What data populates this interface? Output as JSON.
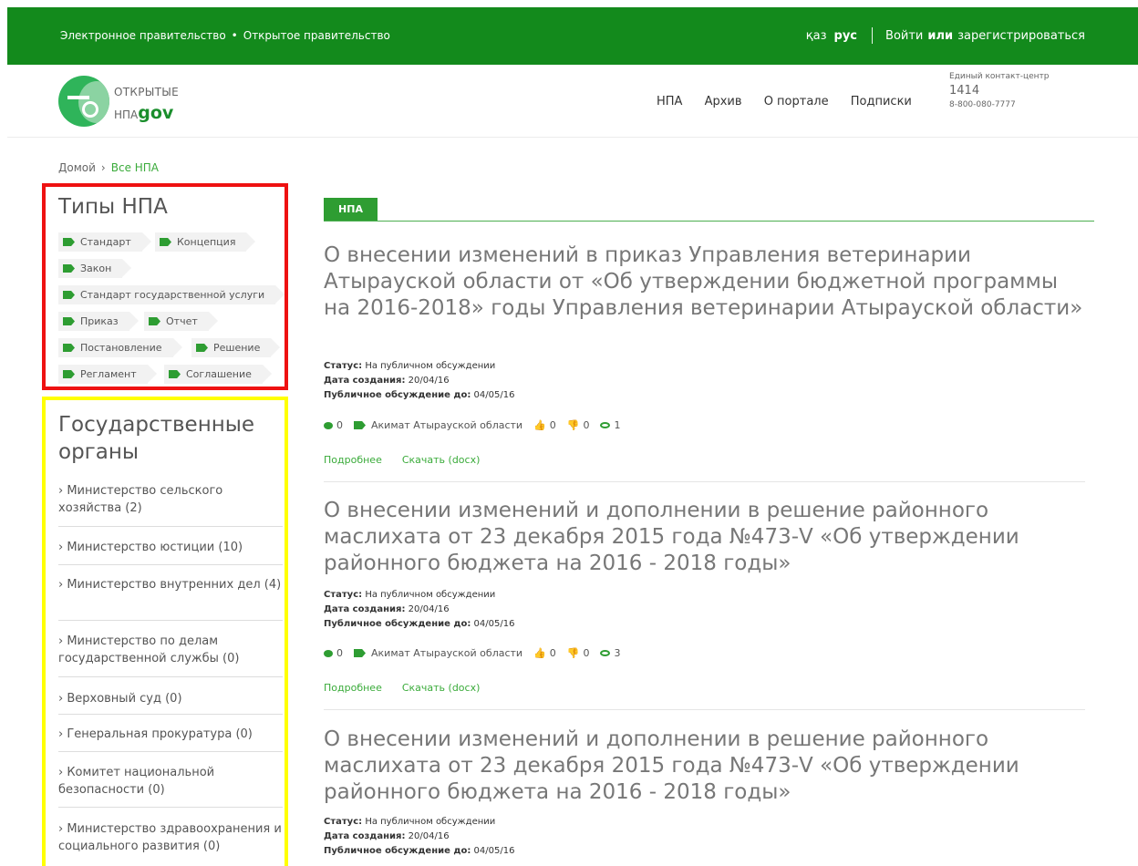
{
  "topbar": {
    "e_gov": "Электронное правительство",
    "dot": "•",
    "open_gov": "Открытое правительство",
    "lang_kz": "қаз",
    "lang_ru": "рус",
    "login": "Войти",
    "or": "или",
    "register": "зарегистрироваться"
  },
  "logo": {
    "line1": "ОТКРЫТЫЕ",
    "line2_prefix": "НПА",
    "line2_gov": "gov"
  },
  "nav": [
    "НПА",
    "Архив",
    "О портале",
    "Подписки"
  ],
  "contact": {
    "label": "Единый контакт-центр",
    "short": "1414",
    "phone": "8-800-080-7777"
  },
  "breadcrumb": {
    "home": "Домой",
    "sep": "›",
    "current": "Все НПА"
  },
  "types": {
    "title": "Типы НПА",
    "tags": [
      "Стандарт",
      "Концепция",
      "Закон",
      "Стандарт государственной услуги",
      "Приказ",
      "Отчет",
      "Постановление",
      "Решение",
      "Регламент",
      "Соглашение"
    ]
  },
  "organs": {
    "title_line1": "Государственные",
    "title_line2": "органы",
    "items": [
      "› Министерство сельского хозяйства (2)",
      "› Министерство юстиции (10)",
      "› Министерство внутренних дел (4)",
      "› Министерство по делам государственной службы (0)",
      "› Верховный суд (0)",
      "› Генеральная прокуратура (0)",
      "› Комитет национальной безопасности (0)",
      "› Министерство здравоохранения и социального развития (0)"
    ]
  },
  "main": {
    "tab": "НПА",
    "posts": [
      {
        "title": "О внесении изменений в приказ Управления ветеринарии Атырауской области от «Об утверждении бюджетной программы на 2016-2018» годы Управления ветеринарии Атырауской области»",
        "status_label": "Статус:",
        "status": "На публичном обсуждении",
        "created_label": "Дата создания:",
        "created": "20/04/16",
        "until_label": "Публичное обсуждение до:",
        "until": "04/05/16",
        "comments": "0",
        "org": "Акимат Атырауской области",
        "likes": "0",
        "dislikes": "0",
        "views": "1",
        "more": "Подробнее",
        "download": "Скачать (docx)"
      },
      {
        "title": "О внесении изменений и дополнении в решение районного маслихата от 23 декабря 2015 года №473-V «Об утверждении районного бюджета на 2016 - 2018 годы»",
        "status_label": "Статус:",
        "status": "На публичном обсуждении",
        "created_label": "Дата создания:",
        "created": "20/04/16",
        "until_label": "Публичное обсуждение до:",
        "until": "04/05/16",
        "comments": "0",
        "org": "Акимат Атырауской области",
        "likes": "0",
        "dislikes": "0",
        "views": "3",
        "more": "Подробнее",
        "download": "Скачать (docx)"
      },
      {
        "title": "О внесении изменений и дополнении в решение районного маслихата от 23 декабря 2015 года №473-V «Об утверждении районного бюджета на 2016 - 2018 годы»",
        "status_label": "Статус:",
        "status": "На публичном обсуждении",
        "created_label": "Дата создания:",
        "created": "20/04/16",
        "until_label": "Публичное обсуждение до:",
        "until": "04/05/16"
      }
    ]
  },
  "colors": {
    "brand_green": "#138a1c",
    "accent_green": "#2e9d32",
    "types_border": "#ee1111",
    "organs_border": "#ffff00"
  }
}
